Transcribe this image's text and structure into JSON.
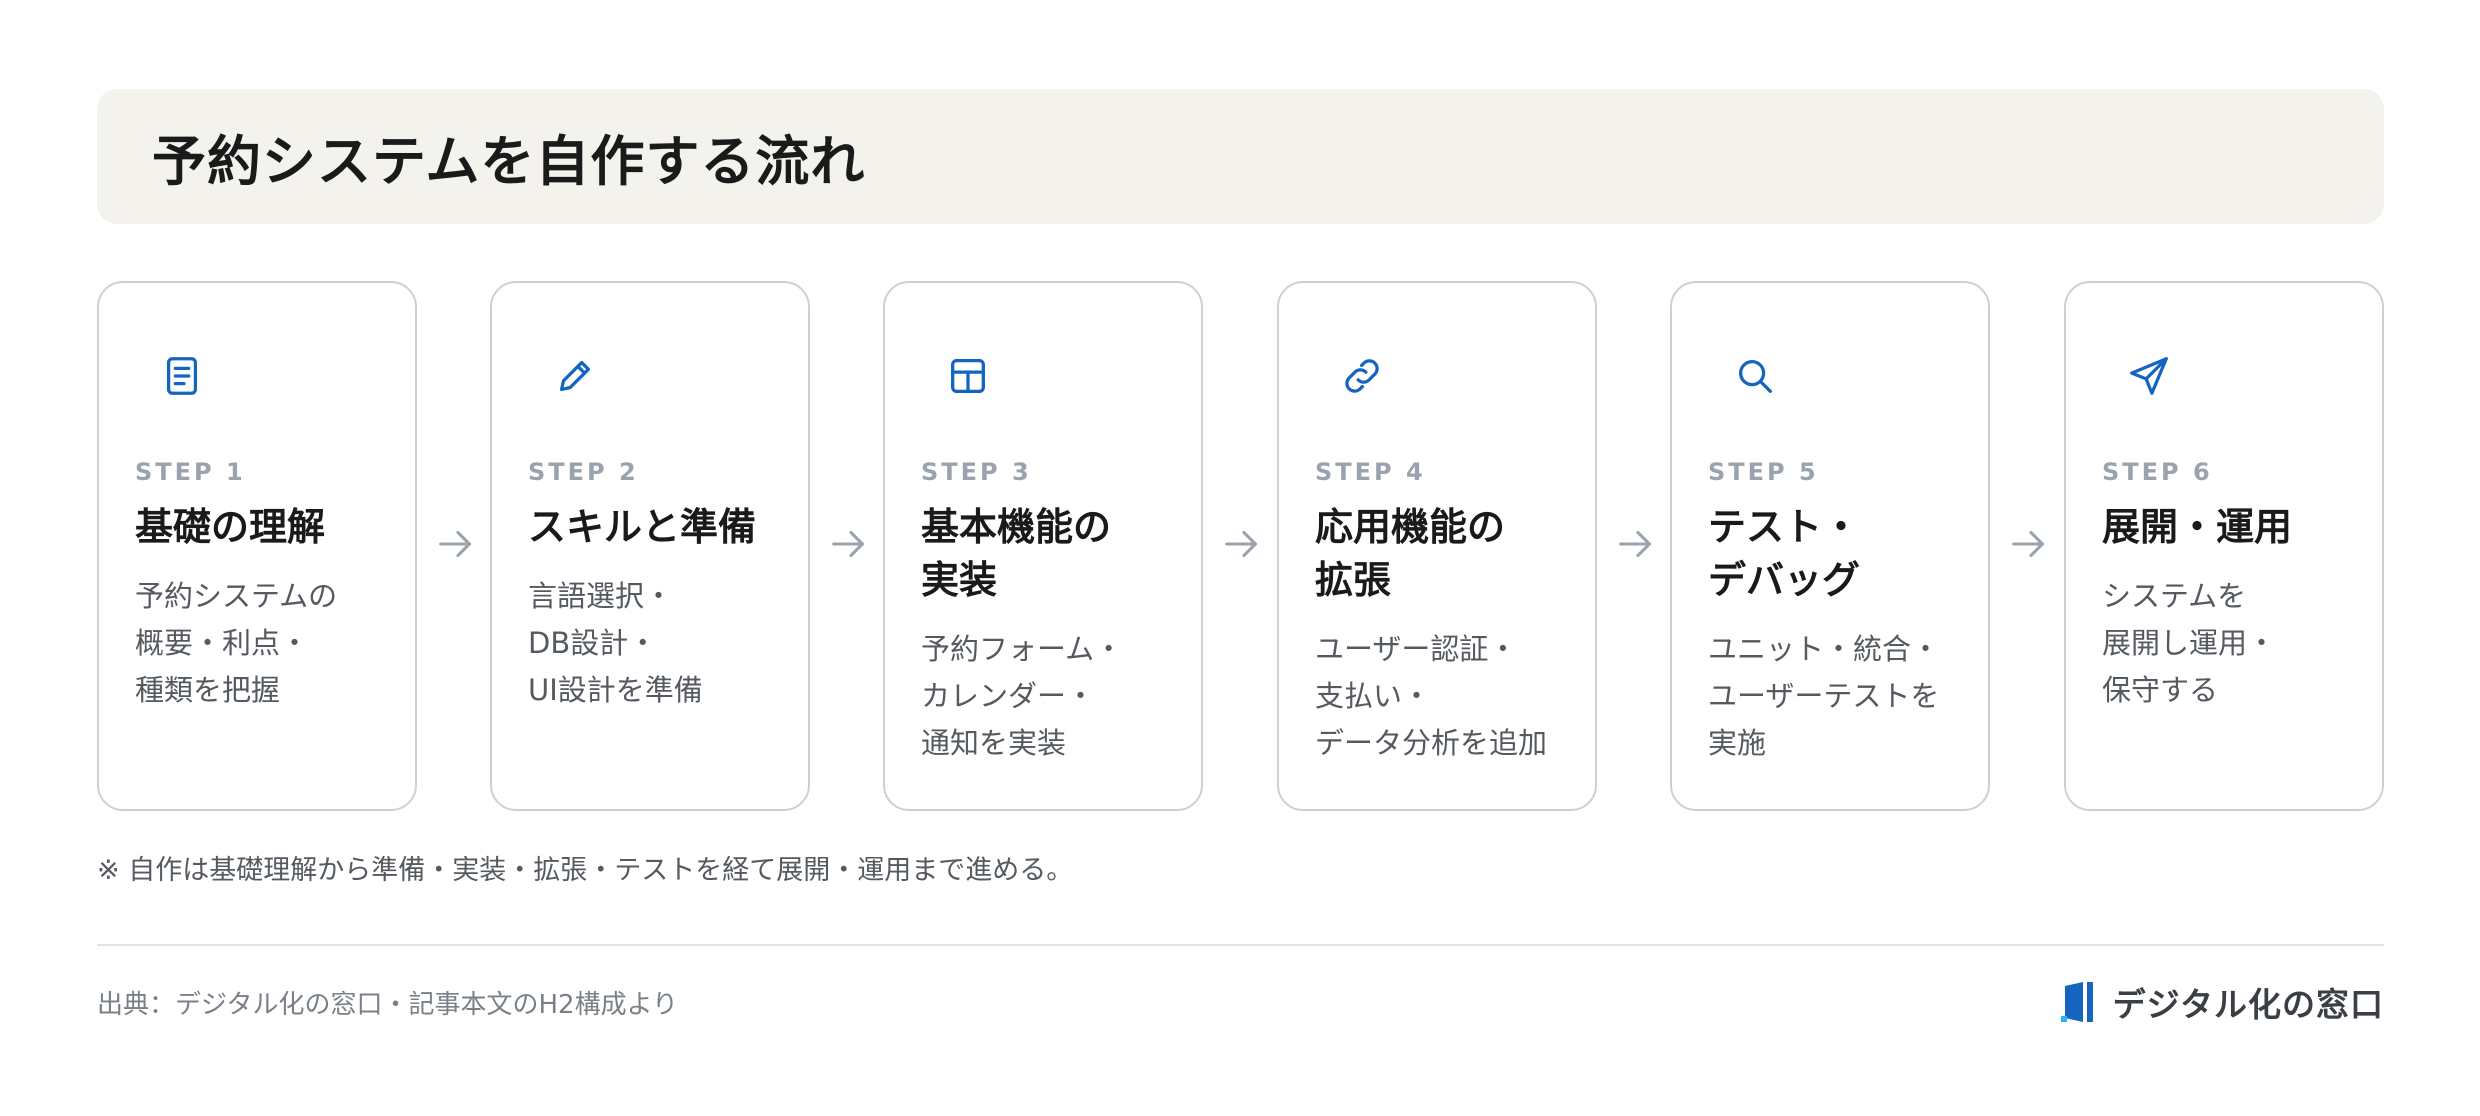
{
  "title": "予約システムを自作する流れ",
  "steps": [
    {
      "icon": "document-icon",
      "label": "STEP 1",
      "title": "基礎の理解",
      "desc": "予約システムの\n概要・利点・\n種類を把握"
    },
    {
      "icon": "pencil-icon",
      "label": "STEP 2",
      "title": "スキルと準備",
      "desc": "言語選択・\nDB設計・\nUI設計を準備"
    },
    {
      "icon": "table-icon",
      "label": "STEP 3",
      "title": "基本機能の\n実装",
      "desc": "予約フォーム・\nカレンダー・\n通知を実装"
    },
    {
      "icon": "link-icon",
      "label": "STEP 4",
      "title": "応用機能の\n拡張",
      "desc": "ユーザー認証・\n支払い・\nデータ分析を追加"
    },
    {
      "icon": "search-icon",
      "label": "STEP 5",
      "title": "テスト・\nデバッグ",
      "desc": "ユニット・統合・\nユーザーテストを\n実施"
    },
    {
      "icon": "send-icon",
      "label": "STEP 6",
      "title": "展開・運用",
      "desc": "システムを\n展開し運用・\n保守する"
    }
  ],
  "note": "※ 自作は基礎理解から準備・実装・拡張・テストを経て展開・運用まで進める。",
  "source": "出典：デジタル化の窓口・記事本文のH2構成より",
  "logo_text": "デジタル化の窓口",
  "colors": {
    "accent": "#1565c0",
    "arrow": "#9aa3ad",
    "title_bg": "#f4f2ed"
  }
}
